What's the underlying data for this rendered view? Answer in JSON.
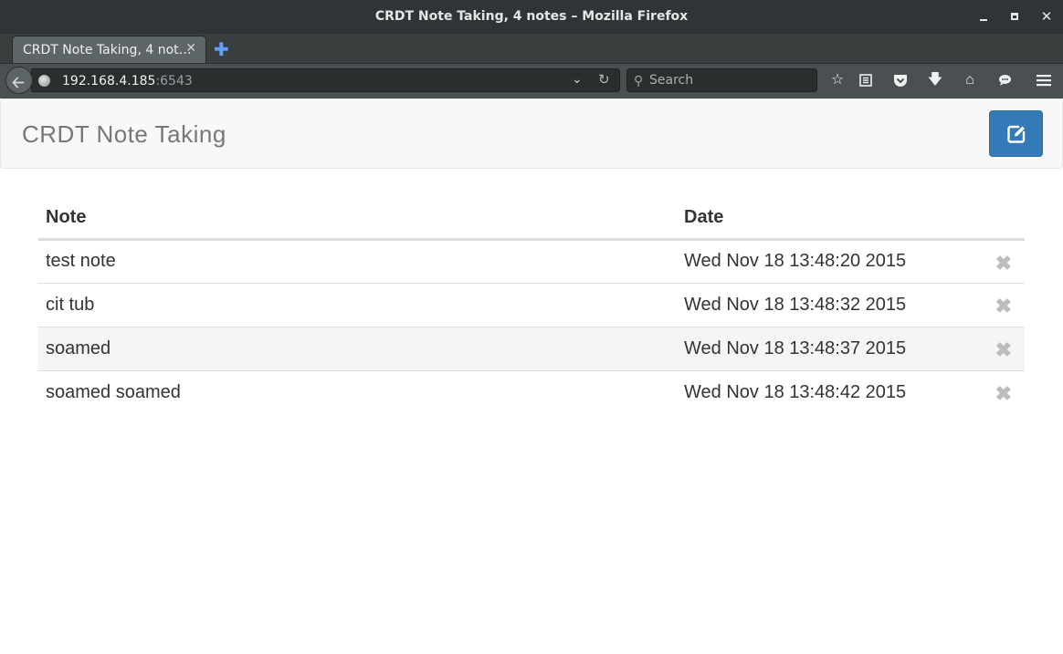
{
  "window": {
    "title": "CRDT Note Taking, 4 notes – Mozilla Firefox"
  },
  "tabs": [
    {
      "label": "CRDT Note Taking, 4 not…"
    }
  ],
  "navbar": {
    "url_host": "192.168.4.185",
    "url_port": ":6543",
    "search_placeholder": "Search",
    "toolbar_icons": [
      "star-icon",
      "reading-list-icon",
      "pocket-icon",
      "download-icon",
      "home-icon",
      "chat-icon",
      "menu-icon"
    ]
  },
  "app": {
    "brand": "CRDT Note Taking",
    "accent_color": "#337ab7"
  },
  "table": {
    "headers": {
      "note": "Note",
      "date": "Date"
    },
    "rows": [
      {
        "note": "test note",
        "date": "Wed Nov 18 13:48:20 2015",
        "delete": "✖"
      },
      {
        "note": "cit tub",
        "date": "Wed Nov 18 13:48:32 2015",
        "delete": "✖"
      },
      {
        "note": "soamed",
        "date": "Wed Nov 18 13:48:37 2015",
        "delete": "✖"
      },
      {
        "note": "soamed soamed",
        "date": "Wed Nov 18 13:48:42 2015",
        "delete": "✖"
      }
    ]
  }
}
